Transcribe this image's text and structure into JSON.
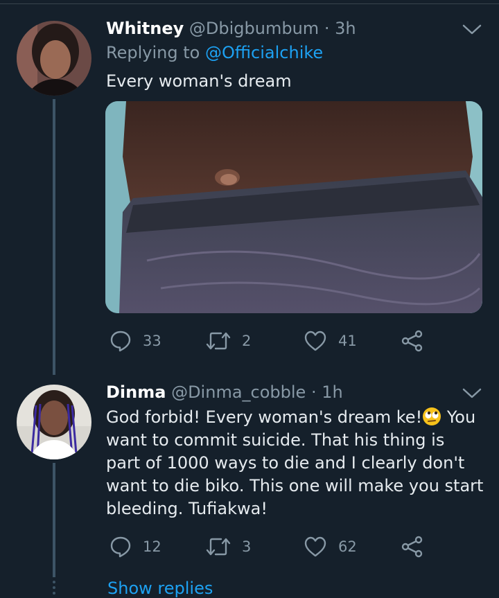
{
  "tweets": [
    {
      "name": "Whitney",
      "handle": "@Dbigbumbum",
      "time": "3h",
      "replying_label": "Replying to",
      "replying_handle": "@Officialchike",
      "text": "Every woman's dream",
      "actions": {
        "replies": "33",
        "retweets": "2",
        "likes": "41"
      }
    },
    {
      "name": "Dinma",
      "handle": "@Dinma_cobble",
      "time": "1h",
      "text_before_emoji": "God forbid! Every woman's dream ke!",
      "emoji": "face-with-rolling-eyes",
      "text_after_emoji": " You want to commit suicide. That his thing is part of 1000 ways to die and I clearly don't want to die biko. This one will make you start bleeding. Tufiakwa!",
      "actions": {
        "replies": "12",
        "retweets": "3",
        "likes": "62"
      }
    }
  ],
  "show_replies": "Show replies",
  "colors": {
    "background": "#15202b",
    "accent": "#1da1f2",
    "muted": "#8899a6",
    "thread": "#3d5466"
  }
}
